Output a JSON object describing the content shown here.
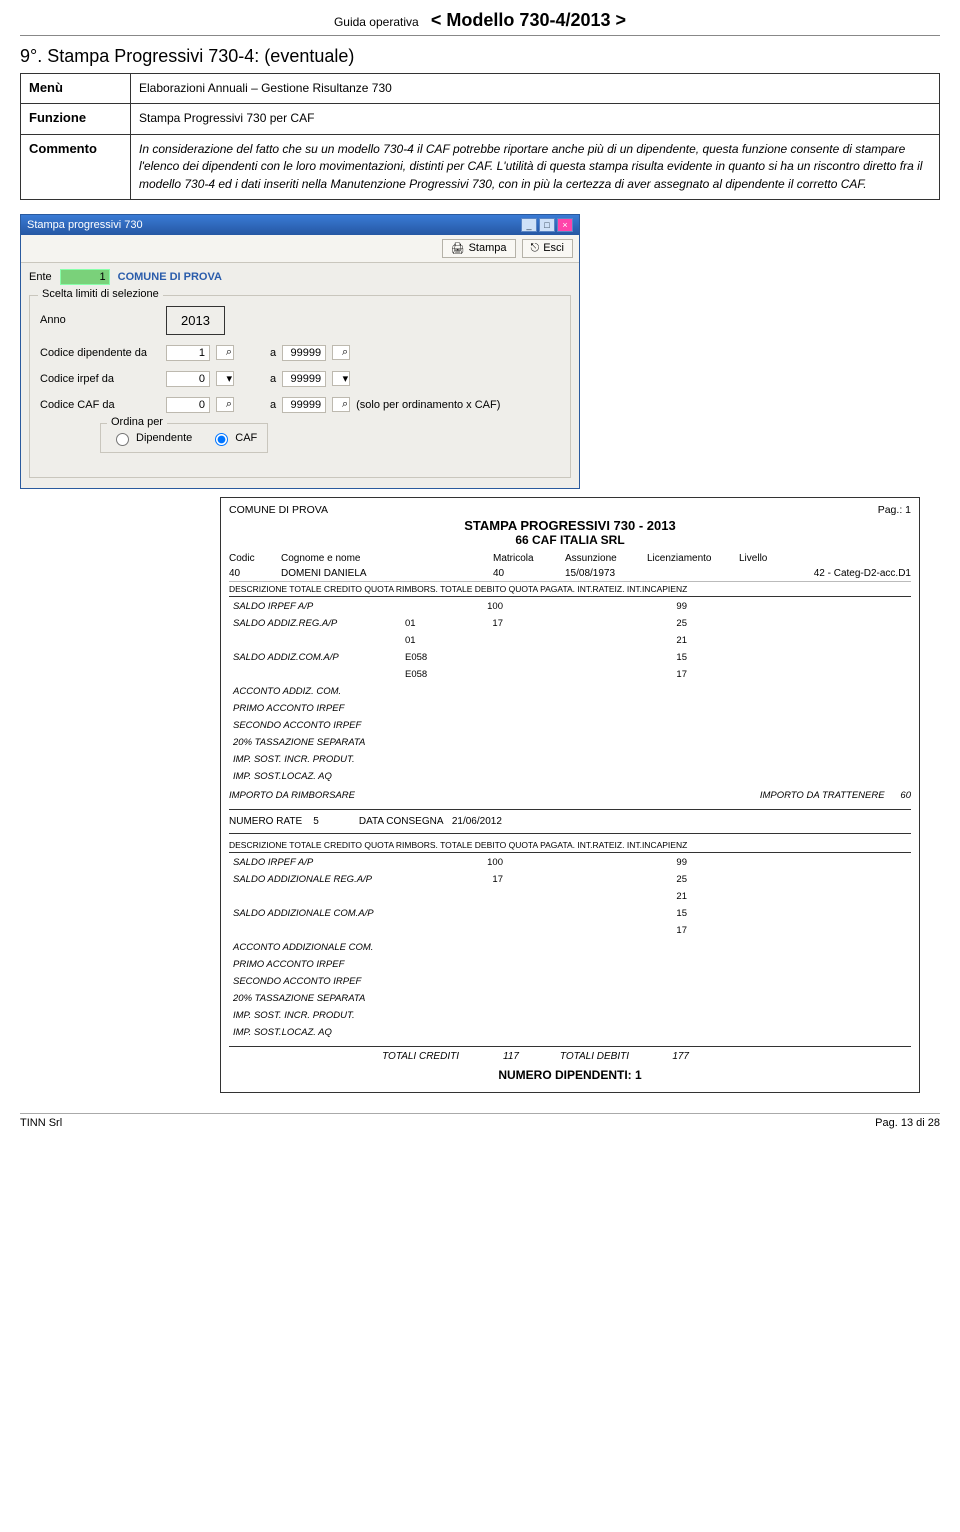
{
  "header": {
    "small": "Guida  operativa",
    "big": "< Modello 730-4/2013 >"
  },
  "section_title": "9°. Stampa Progressivi  730-4: (eventuale)",
  "info": {
    "menu_lbl": "Menù",
    "menu_val": "Elaborazioni Annuali – Gestione Risultanze  730",
    "funz_lbl": "Funzione",
    "funz_val": "Stampa Progressivi  730 per CAF",
    "comm_lbl": "Commento",
    "comm_val": "In considerazione del fatto che su un modello 730-4 il CAF potrebbe riportare anche più di un dipendente, questa funzione consente di stampare l'elenco dei dipendenti con le loro movimentazioni, distinti per CAF. L'utilità di questa stampa risulta evidente in quanto si ha un riscontro diretto fra il modello 730-4 ed i dati inseriti nella Manutenzione Progressivi 730, con in più la certezza di aver assegnato al dipendente il corretto CAF."
  },
  "win": {
    "title": "Stampa progressivi 730",
    "btn_stampa": "Stampa",
    "btn_esci": "Esci",
    "ente_lbl": "Ente",
    "ente_val": "1",
    "ente_name": "COMUNE DI PROVA",
    "group_lbl": "Scelta limiti di selezione",
    "anno_lbl": "Anno",
    "anno_val": "2013",
    "cod_dip_lbl": "Codice dipendente da",
    "cod_dip_da": "1",
    "a_lbl": "a",
    "cod_dip_a": "99999",
    "cod_irp_lbl": "Codice irpef da",
    "cod_irp_da": "0",
    "cod_irp_a": "99999",
    "cod_caf_lbl": "Codice CAF da",
    "cod_caf_da": "0",
    "cod_caf_a": "99999",
    "caf_hint": "(solo per  ordinamento x CAF)",
    "ordina_lbl": "Ordina per",
    "opt_dip": "Dipendente",
    "opt_caf": "CAF"
  },
  "report": {
    "org": "COMUNE DI PROVA",
    "pag": "Pag.:       1",
    "title": "STAMPA PROGRESSIVI 730 - 2013",
    "sub": "66 CAF ITALIA SRL",
    "emp_hdr": {
      "codic": "Codic",
      "cogn": "Cognome e nome",
      "matr": "Matricola",
      "ass": "Assunzione",
      "lic": "Licenziamento",
      "liv": "Livello"
    },
    "emp": {
      "codic": "40",
      "name": "DOMENI DANIELA",
      "matr": "40",
      "ass": "15/08/1973",
      "liv": "42 - Categ-D2-acc.D1"
    },
    "cols": "DESCRIZIONE       TOTALE CREDITO  QUOTA RIMBORS.   TOTALE DEBITO  QUOTA PAGATA.   INT.RATEIZ.  INT.INCAPIENZ",
    "rows1": [
      {
        "d": "SALDO IRPEF A/P",
        "c1": "",
        "c2": "100",
        "c3": "",
        "c4": "99"
      },
      {
        "d": "SALDO ADDIZ.REG.A/P",
        "c1": "01",
        "c2": "17",
        "c3": "",
        "c4": "25"
      },
      {
        "d": "",
        "c1": "01",
        "c2": "",
        "c3": "",
        "c4": "21"
      },
      {
        "d": "SALDO ADDIZ.COM.A/P",
        "c1": "E058",
        "c2": "",
        "c3": "",
        "c4": "15"
      },
      {
        "d": "",
        "c1": "E058",
        "c2": "",
        "c3": "",
        "c4": "17"
      },
      {
        "d": "ACCONTO ADDIZ. COM.",
        "c1": "",
        "c2": "",
        "c3": "",
        "c4": ""
      },
      {
        "d": "PRIMO ACCONTO IRPEF",
        "c1": "",
        "c2": "",
        "c3": "",
        "c4": ""
      },
      {
        "d": "SECONDO ACCONTO IRPEF",
        "c1": "",
        "c2": "",
        "c3": "",
        "c4": ""
      },
      {
        "d": "20% TASSAZIONE SEPARATA",
        "c1": "",
        "c2": "",
        "c3": "",
        "c4": ""
      },
      {
        "d": "IMP. SOST. INCR. PRODUT.",
        "c1": "",
        "c2": "",
        "c3": "",
        "c4": ""
      },
      {
        "d": "IMP. SOST.LOCAZ. AQ",
        "c1": "",
        "c2": "",
        "c3": "",
        "c4": ""
      }
    ],
    "mid_left_lbl": "IMPORTO DA RIMBORSARE",
    "mid_right_lbl": "IMPORTO DA TRATTENERE",
    "mid_right_val": "60",
    "rate_lbl": "NUMERO RATE",
    "rate_val": "5",
    "consegna_lbl": "DATA CONSEGNA",
    "consegna_val": "21/06/2012",
    "rows2": [
      {
        "d": "SALDO IRPEF A/P",
        "c1": "",
        "c2": "100",
        "c3": "",
        "c4": "99"
      },
      {
        "d": "SALDO ADDIZIONALE REG.A/P",
        "c1": "",
        "c2": "17",
        "c3": "",
        "c4": "25"
      },
      {
        "d": "",
        "c1": "",
        "c2": "",
        "c3": "",
        "c4": "21"
      },
      {
        "d": "SALDO ADDIZIONALE COM.A/P",
        "c1": "",
        "c2": "",
        "c3": "",
        "c4": "15"
      },
      {
        "d": "",
        "c1": "",
        "c2": "",
        "c3": "",
        "c4": "17"
      },
      {
        "d": "ACCONTO ADDIZIONALE COM.",
        "c1": "",
        "c2": "",
        "c3": "",
        "c4": ""
      },
      {
        "d": "PRIMO ACCONTO IRPEF",
        "c1": "",
        "c2": "",
        "c3": "",
        "c4": ""
      },
      {
        "d": "SECONDO ACCONTO IRPEF",
        "c1": "",
        "c2": "",
        "c3": "",
        "c4": ""
      },
      {
        "d": "20% TASSAZIONE SEPARATA",
        "c1": "",
        "c2": "",
        "c3": "",
        "c4": ""
      },
      {
        "d": "IMP. SOST. INCR. PRODUT.",
        "c1": "",
        "c2": "",
        "c3": "",
        "c4": ""
      },
      {
        "d": "IMP. SOST.LOCAZ. AQ",
        "c1": "",
        "c2": "",
        "c3": "",
        "c4": ""
      }
    ],
    "tot_cred_lbl": "TOTALI CREDITI",
    "tot_cred_val": "117",
    "tot_deb_lbl": "TOTALI DEBITI",
    "tot_deb_val": "177",
    "numdip": "NUMERO DIPENDENTI: 1"
  },
  "footer": {
    "left": "TINN  Srl",
    "right": "Pag. 13 di 28"
  }
}
